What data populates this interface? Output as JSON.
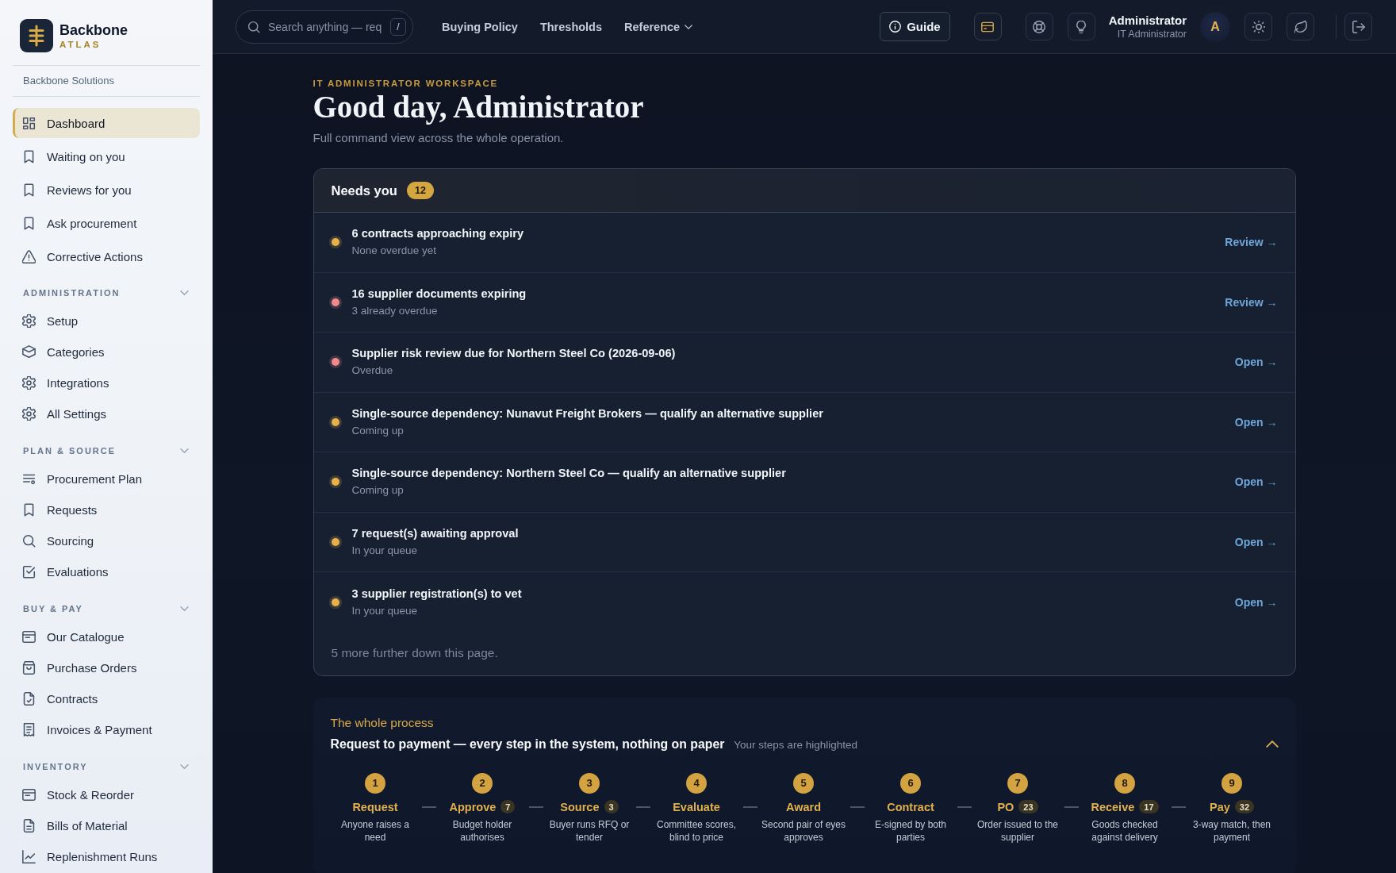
{
  "sidebar": {
    "brand": {
      "name": "Backbone",
      "tagline": "ATLAS"
    },
    "organization": "Backbone Solutions",
    "nav": [
      {
        "label": "Dashboard",
        "selected": true
      },
      {
        "label": "Waiting on you",
        "selected": false
      },
      {
        "label": "Reviews for you",
        "selected": false
      },
      {
        "label": "Ask procurement",
        "selected": false
      },
      {
        "label": "Corrective Actions",
        "selected": false
      }
    ],
    "sections": [
      {
        "title": "ADMINISTRATION",
        "expanded": true,
        "items": [
          {
            "label": "Setup",
            "selected": false
          },
          {
            "label": "Categories",
            "selected": false
          },
          {
            "label": "Integrations",
            "selected": false
          },
          {
            "label": "All Settings",
            "selected": false
          }
        ]
      },
      {
        "title": "PLAN & SOURCE",
        "expanded": true,
        "items": [
          {
            "label": "Procurement Plan",
            "selected": false
          },
          {
            "label": "Requests",
            "selected": false
          },
          {
            "label": "Sourcing",
            "selected": false
          },
          {
            "label": "Evaluations",
            "selected": false
          }
        ]
      },
      {
        "title": "BUY & PAY",
        "expanded": true,
        "items": [
          {
            "label": "Our Catalogue",
            "selected": false
          },
          {
            "label": "Purchase Orders",
            "selected": false
          },
          {
            "label": "Contracts",
            "selected": false
          },
          {
            "label": "Invoices & Payment",
            "selected": false
          }
        ]
      },
      {
        "title": "INVENTORY",
        "expanded": true,
        "items": [
          {
            "label": "Stock & Reorder",
            "selected": false
          },
          {
            "label": "Bills of Material",
            "selected": false
          },
          {
            "label": "Replenishment Runs",
            "selected": false
          }
        ]
      }
    ]
  },
  "top_bar": {
    "search": {
      "placeholder": "Search anything — req",
      "shortcut": "/"
    },
    "links": [
      {
        "label": "Buying Policy",
        "kind": "link"
      },
      {
        "label": "Thresholds",
        "kind": "link"
      },
      {
        "label": "Reference",
        "kind": "menu"
      }
    ],
    "guide_button": "Guide",
    "user": {
      "name": "Administrator",
      "role": "IT Administrator",
      "initial": "A"
    }
  },
  "header": {
    "eyebrow": "IT ADMINISTRATOR WORKSPACE",
    "title": "Good day, Administrator",
    "subtitle": "Full command view across the whole operation."
  },
  "needs_you": {
    "title": "Needs you",
    "count": "12",
    "items": [
      {
        "title": "6 contracts approaching expiry",
        "detail": "None overdue yet",
        "action": "Review →",
        "color": "#e8b04a"
      },
      {
        "title": "16 supplier documents expiring",
        "detail": "3 already overdue",
        "action": "Review →",
        "color": "#f08a8a"
      },
      {
        "title": "Supplier risk review due for Northern Steel Co (2026-09-06)",
        "detail": "Overdue",
        "action": "Open →",
        "color": "#f08a8a"
      },
      {
        "title": "Single-source dependency: Nunavut Freight Brokers — qualify an alternative supplier",
        "detail": "Coming up",
        "action": "Open →",
        "color": "#e8b04a"
      },
      {
        "title": "Single-source dependency: Northern Steel Co — qualify an alternative supplier",
        "detail": "Coming up",
        "action": "Open →",
        "color": "#e8b04a"
      },
      {
        "title": "7 request(s) awaiting approval",
        "detail": "In your queue",
        "action": "Open →",
        "color": "#e8b04a"
      },
      {
        "title": "3 supplier registration(s) to vet",
        "detail": "In your queue",
        "action": "Open →",
        "color": "#e8b04a"
      }
    ],
    "footer": "5 more further down this page."
  },
  "process": {
    "eyebrow": "The whole process",
    "title": "Request to payment — every step in the system, nothing on paper",
    "hint": "Your steps are highlighted",
    "expanded": true,
    "steps": [
      {
        "number": "1",
        "name": "Request",
        "description": "Anyone raises a need",
        "highlighted": true
      },
      {
        "number": "2",
        "name": "Approve",
        "count": "7",
        "description": "Budget holder authorises",
        "highlighted": true
      },
      {
        "number": "3",
        "name": "Source",
        "count": "3",
        "description": "Buyer runs RFQ or tender",
        "highlighted": true
      },
      {
        "number": "4",
        "name": "Evaluate",
        "description": "Committee scores, blind to price",
        "highlighted": true
      },
      {
        "number": "5",
        "name": "Award",
        "description": "Second pair of eyes approves",
        "highlighted": true
      },
      {
        "number": "6",
        "name": "Contract",
        "description": "E-signed by both parties",
        "highlighted": true
      },
      {
        "number": "7",
        "name": "PO",
        "count": "23",
        "description": "Order issued to the supplier",
        "highlighted": true
      },
      {
        "number": "8",
        "name": "Receive",
        "count": "17",
        "description": "Goods checked against delivery",
        "highlighted": true
      },
      {
        "number": "9",
        "name": "Pay",
        "count": "32",
        "description": "3-way match, then payment",
        "highlighted": true
      }
    ]
  }
}
